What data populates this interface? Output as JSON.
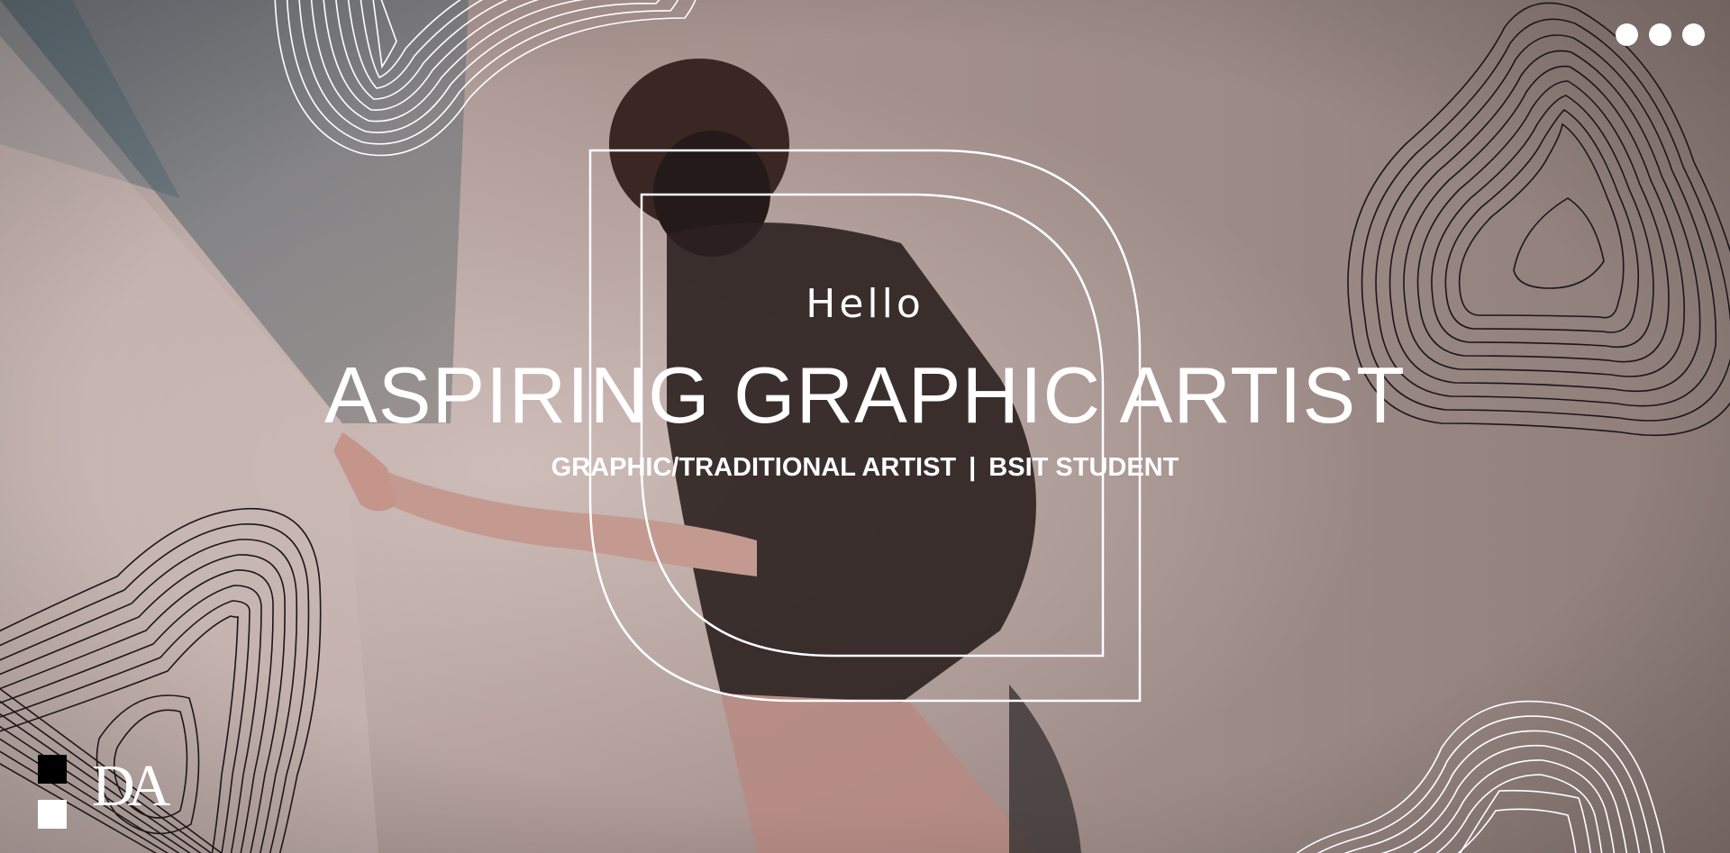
{
  "hero": {
    "greeting": "Hello",
    "headline": "ASPIRING GRAPHIC ARTIST",
    "subtitle_left": "GRAPHIC/TRADITIONAL ARTIST",
    "subtitle_separator": "|",
    "subtitle_right": "BSIT STUDENT"
  },
  "menu": {
    "icon": "more-dots-icon"
  },
  "logo": {
    "text": "DA"
  },
  "colors": {
    "text": "#ffffff",
    "background": "#8f7f7b",
    "contour_dark": "#1b1717",
    "contour_light": "#ffffff"
  }
}
